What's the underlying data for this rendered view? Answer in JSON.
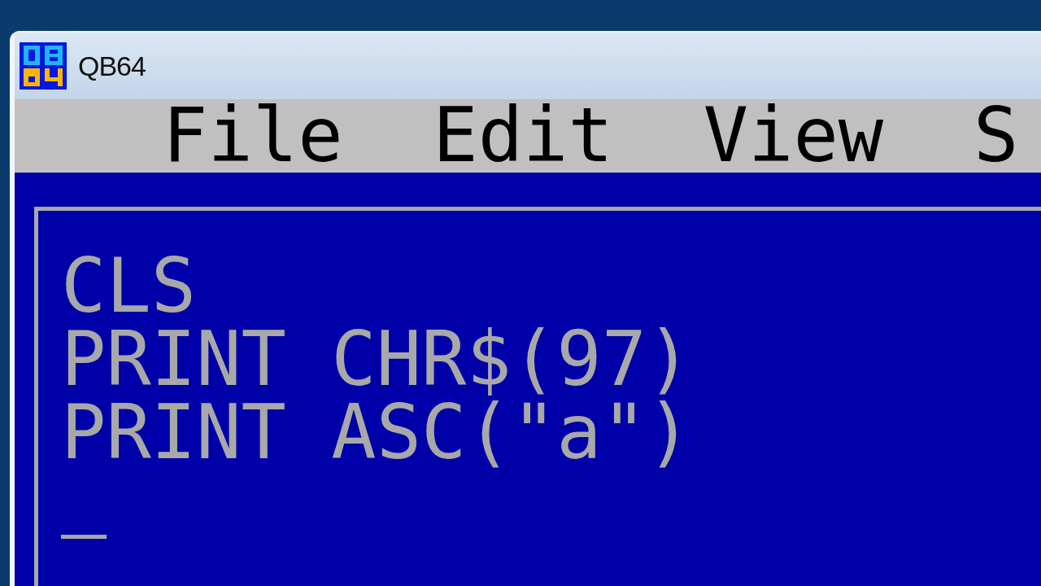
{
  "window": {
    "title": "QB64"
  },
  "menu": [
    {
      "label": "File"
    },
    {
      "label": "Edit"
    },
    {
      "label": "View"
    },
    {
      "label": "S"
    }
  ],
  "editor": {
    "lines": [
      "CLS",
      "PRINT CHR$(97)",
      "PRINT ASC(\"a\")"
    ]
  }
}
